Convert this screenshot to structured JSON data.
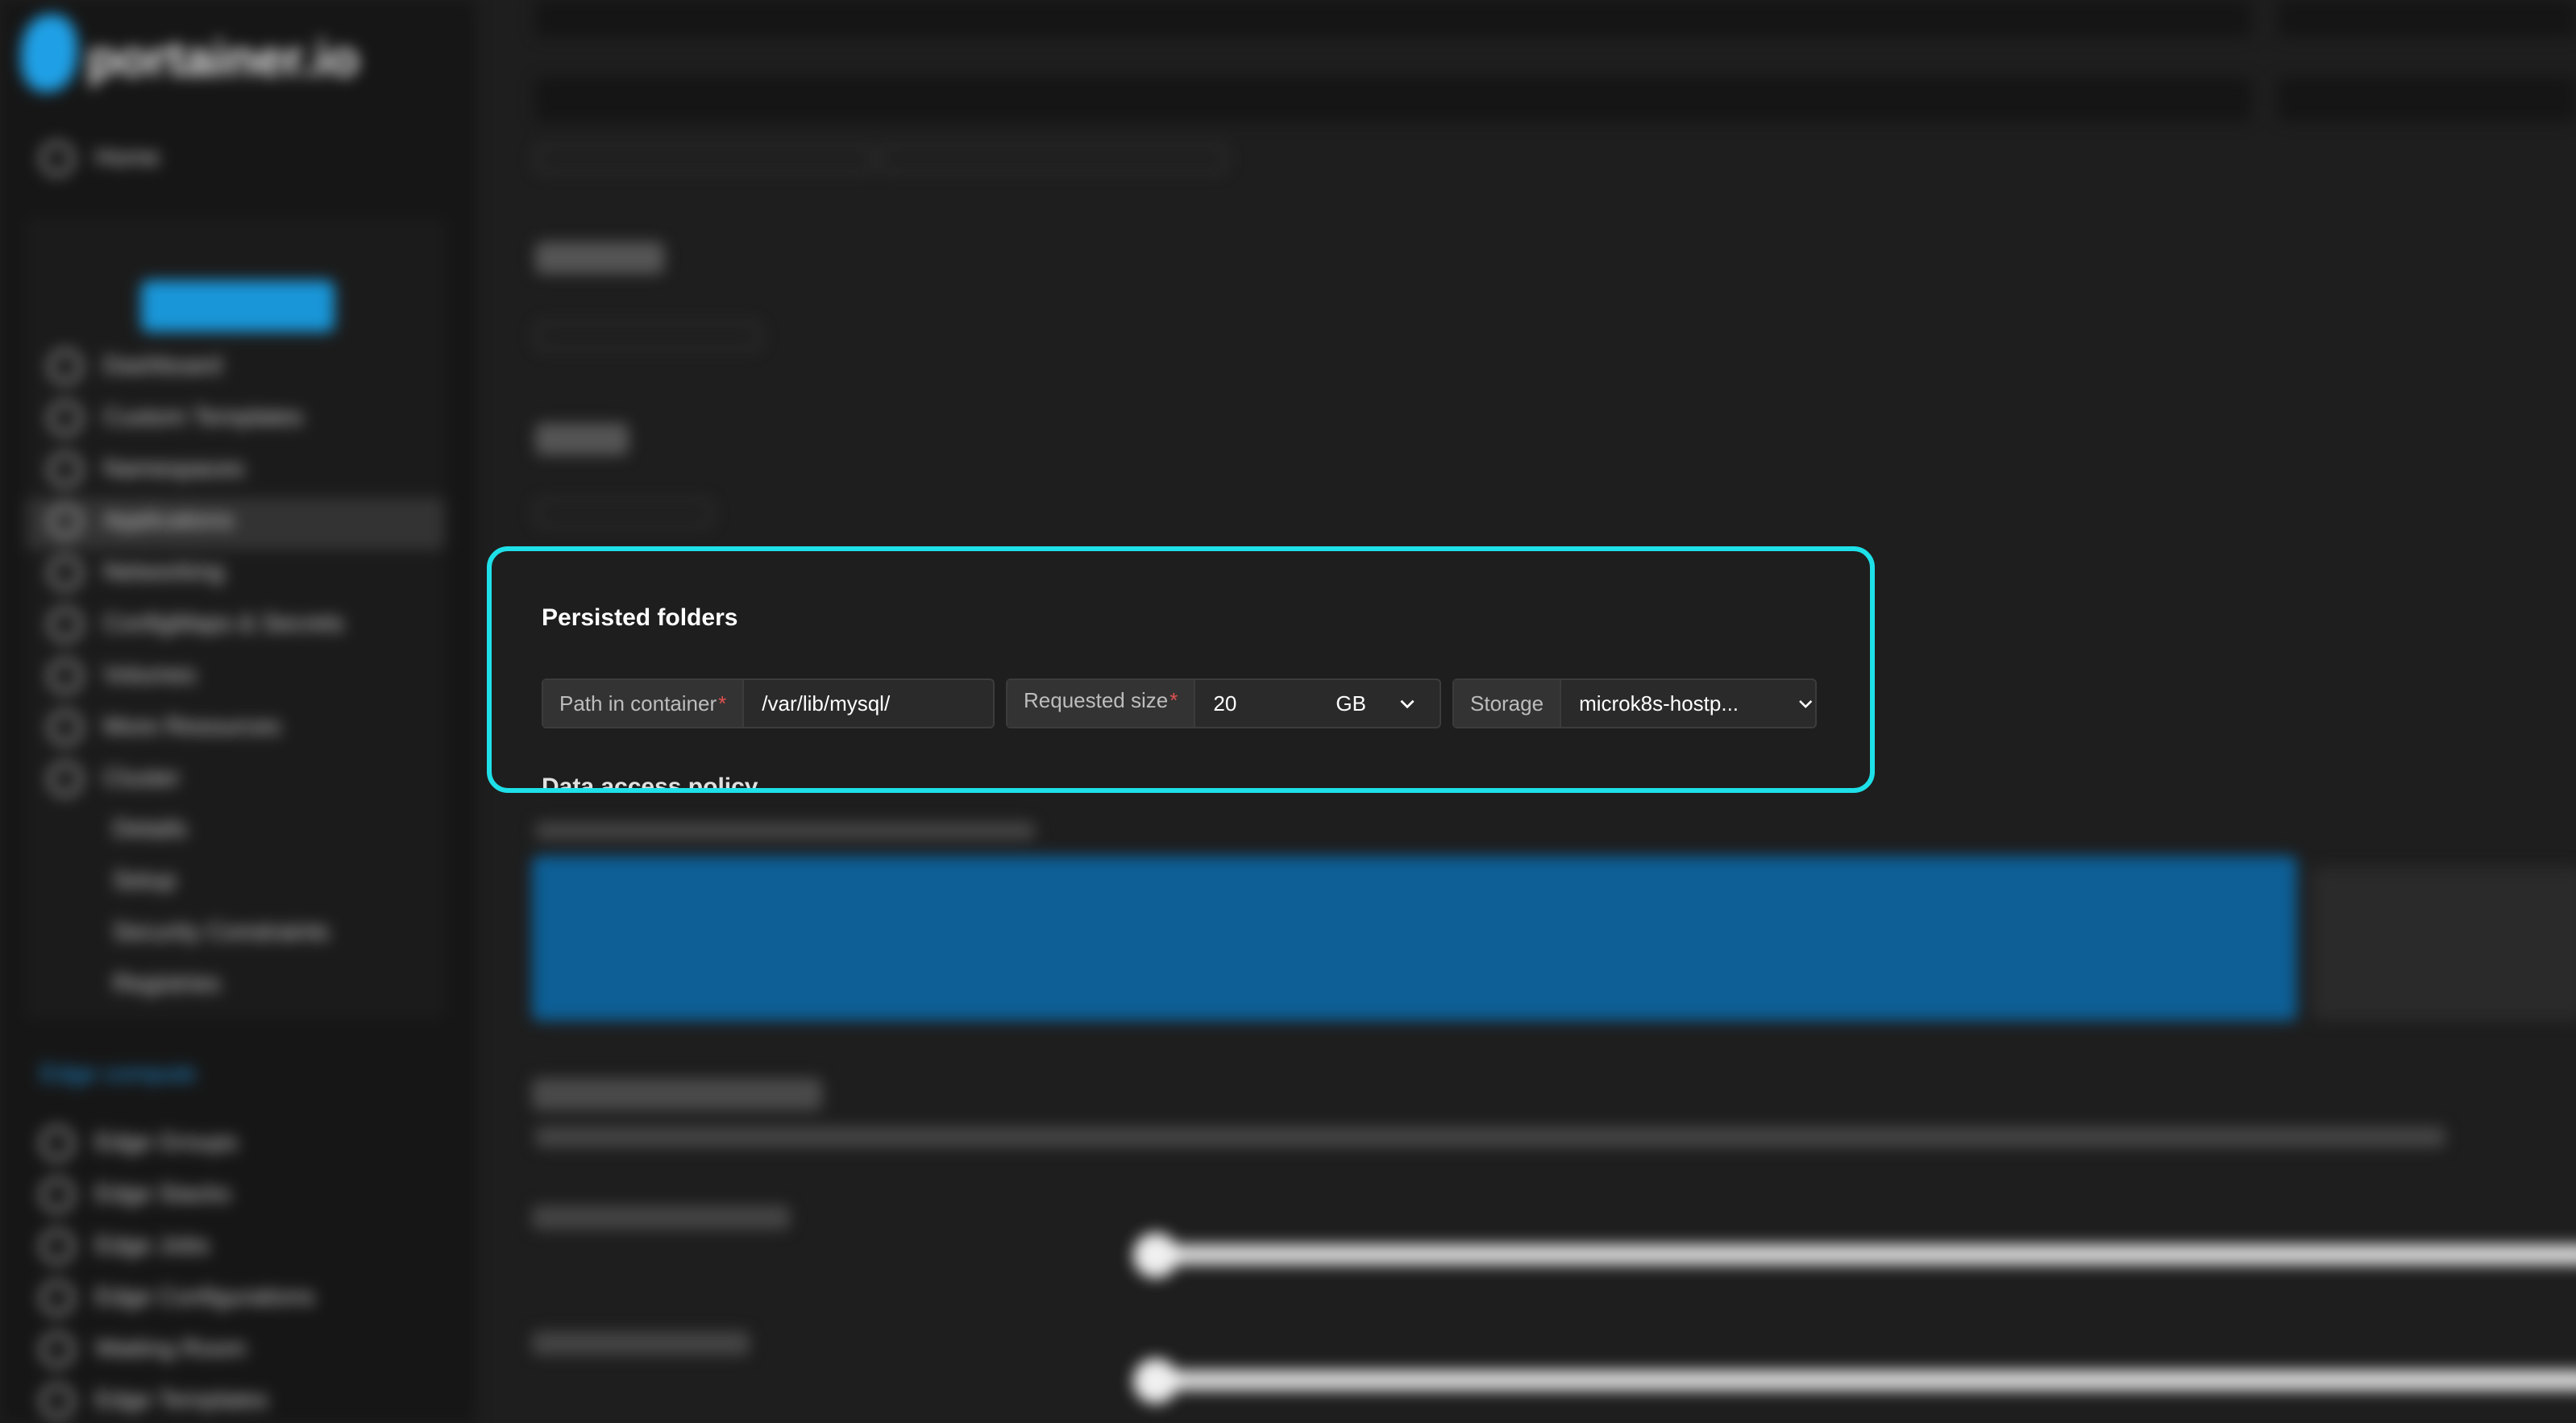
{
  "panel": {
    "title": "Persisted folders",
    "path_label": "Path in container",
    "path_value": "/var/lib/mysql/",
    "size_label": "Requested size",
    "size_value": "20",
    "size_unit": "GB",
    "storage_label": "Storage",
    "storage_value": "microk8s-hostp...",
    "next_section": "Data access policy"
  },
  "colors": {
    "highlight": "#1ee0e8",
    "required": "#e05050",
    "accent": "#1996d8"
  }
}
